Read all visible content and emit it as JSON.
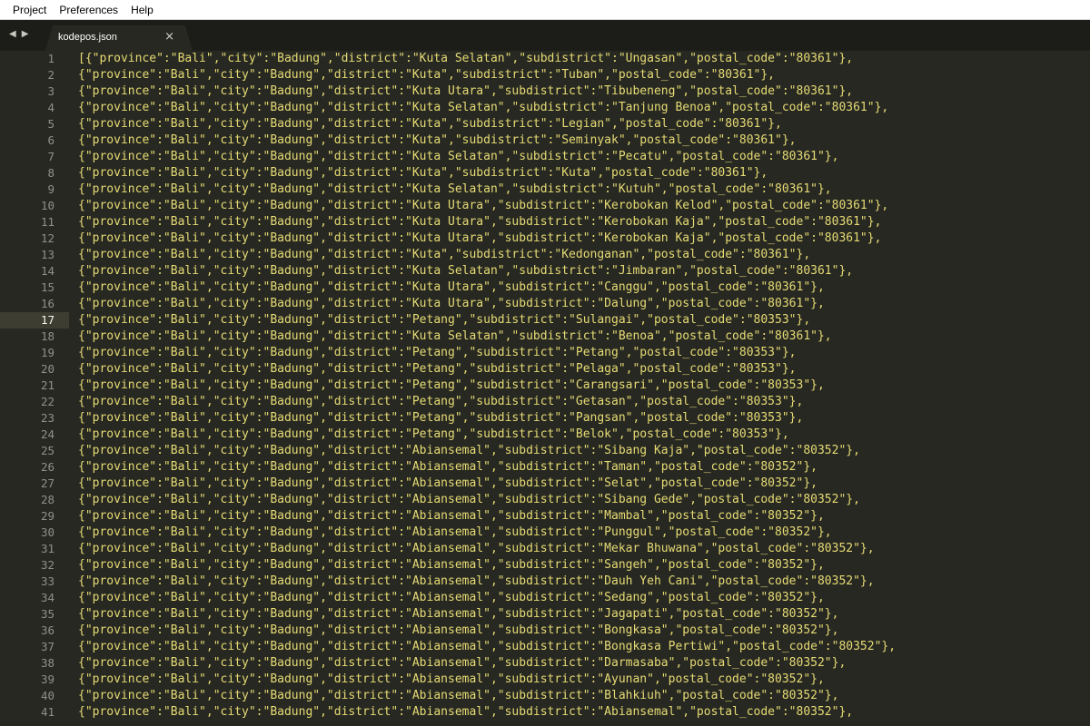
{
  "menu": [
    "Project",
    "Preferences",
    "Help"
  ],
  "tab": {
    "title": "kodepos.json",
    "close": "×"
  },
  "nav": {
    "back": "◀",
    "forward": "▶"
  },
  "active_line": 17,
  "lines": [
    "[{\"province\":\"Bali\",\"city\":\"Badung\",\"district\":\"Kuta Selatan\",\"subdistrict\":\"Ungasan\",\"postal_code\":\"80361\"},",
    "{\"province\":\"Bali\",\"city\":\"Badung\",\"district\":\"Kuta\",\"subdistrict\":\"Tuban\",\"postal_code\":\"80361\"},",
    "{\"province\":\"Bali\",\"city\":\"Badung\",\"district\":\"Kuta Utara\",\"subdistrict\":\"Tibubeneng\",\"postal_code\":\"80361\"},",
    "{\"province\":\"Bali\",\"city\":\"Badung\",\"district\":\"Kuta Selatan\",\"subdistrict\":\"Tanjung Benoa\",\"postal_code\":\"80361\"},",
    "{\"province\":\"Bali\",\"city\":\"Badung\",\"district\":\"Kuta\",\"subdistrict\":\"Legian\",\"postal_code\":\"80361\"},",
    "{\"province\":\"Bali\",\"city\":\"Badung\",\"district\":\"Kuta\",\"subdistrict\":\"Seminyak\",\"postal_code\":\"80361\"},",
    "{\"province\":\"Bali\",\"city\":\"Badung\",\"district\":\"Kuta Selatan\",\"subdistrict\":\"Pecatu\",\"postal_code\":\"80361\"},",
    "{\"province\":\"Bali\",\"city\":\"Badung\",\"district\":\"Kuta\",\"subdistrict\":\"Kuta\",\"postal_code\":\"80361\"},",
    "{\"province\":\"Bali\",\"city\":\"Badung\",\"district\":\"Kuta Selatan\",\"subdistrict\":\"Kutuh\",\"postal_code\":\"80361\"},",
    "{\"province\":\"Bali\",\"city\":\"Badung\",\"district\":\"Kuta Utara\",\"subdistrict\":\"Kerobokan Kelod\",\"postal_code\":\"80361\"},",
    "{\"province\":\"Bali\",\"city\":\"Badung\",\"district\":\"Kuta Utara\",\"subdistrict\":\"Kerobokan Kaja\",\"postal_code\":\"80361\"},",
    "{\"province\":\"Bali\",\"city\":\"Badung\",\"district\":\"Kuta Utara\",\"subdistrict\":\"Kerobokan Kaja\",\"postal_code\":\"80361\"},",
    "{\"province\":\"Bali\",\"city\":\"Badung\",\"district\":\"Kuta\",\"subdistrict\":\"Kedonganan\",\"postal_code\":\"80361\"},",
    "{\"province\":\"Bali\",\"city\":\"Badung\",\"district\":\"Kuta Selatan\",\"subdistrict\":\"Jimbaran\",\"postal_code\":\"80361\"},",
    "{\"province\":\"Bali\",\"city\":\"Badung\",\"district\":\"Kuta Utara\",\"subdistrict\":\"Canggu\",\"postal_code\":\"80361\"},",
    "{\"province\":\"Bali\",\"city\":\"Badung\",\"district\":\"Kuta Utara\",\"subdistrict\":\"Dalung\",\"postal_code\":\"80361\"},",
    "{\"province\":\"Bali\",\"city\":\"Badung\",\"district\":\"Petang\",\"subdistrict\":\"Sulangai\",\"postal_code\":\"80353\"},",
    "{\"province\":\"Bali\",\"city\":\"Badung\",\"district\":\"Kuta Selatan\",\"subdistrict\":\"Benoa\",\"postal_code\":\"80361\"},",
    "{\"province\":\"Bali\",\"city\":\"Badung\",\"district\":\"Petang\",\"subdistrict\":\"Petang\",\"postal_code\":\"80353\"},",
    "{\"province\":\"Bali\",\"city\":\"Badung\",\"district\":\"Petang\",\"subdistrict\":\"Pelaga\",\"postal_code\":\"80353\"},",
    "{\"province\":\"Bali\",\"city\":\"Badung\",\"district\":\"Petang\",\"subdistrict\":\"Carangsari\",\"postal_code\":\"80353\"},",
    "{\"province\":\"Bali\",\"city\":\"Badung\",\"district\":\"Petang\",\"subdistrict\":\"Getasan\",\"postal_code\":\"80353\"},",
    "{\"province\":\"Bali\",\"city\":\"Badung\",\"district\":\"Petang\",\"subdistrict\":\"Pangsan\",\"postal_code\":\"80353\"},",
    "{\"province\":\"Bali\",\"city\":\"Badung\",\"district\":\"Petang\",\"subdistrict\":\"Belok\",\"postal_code\":\"80353\"},",
    "{\"province\":\"Bali\",\"city\":\"Badung\",\"district\":\"Abiansemal\",\"subdistrict\":\"Sibang Kaja\",\"postal_code\":\"80352\"},",
    "{\"province\":\"Bali\",\"city\":\"Badung\",\"district\":\"Abiansemal\",\"subdistrict\":\"Taman\",\"postal_code\":\"80352\"},",
    "{\"province\":\"Bali\",\"city\":\"Badung\",\"district\":\"Abiansemal\",\"subdistrict\":\"Selat\",\"postal_code\":\"80352\"},",
    "{\"province\":\"Bali\",\"city\":\"Badung\",\"district\":\"Abiansemal\",\"subdistrict\":\"Sibang Gede\",\"postal_code\":\"80352\"},",
    "{\"province\":\"Bali\",\"city\":\"Badung\",\"district\":\"Abiansemal\",\"subdistrict\":\"Mambal\",\"postal_code\":\"80352\"},",
    "{\"province\":\"Bali\",\"city\":\"Badung\",\"district\":\"Abiansemal\",\"subdistrict\":\"Punggul\",\"postal_code\":\"80352\"},",
    "{\"province\":\"Bali\",\"city\":\"Badung\",\"district\":\"Abiansemal\",\"subdistrict\":\"Mekar Bhuwana\",\"postal_code\":\"80352\"},",
    "{\"province\":\"Bali\",\"city\":\"Badung\",\"district\":\"Abiansemal\",\"subdistrict\":\"Sangeh\",\"postal_code\":\"80352\"},",
    "{\"province\":\"Bali\",\"city\":\"Badung\",\"district\":\"Abiansemal\",\"subdistrict\":\"Dauh Yeh Cani\",\"postal_code\":\"80352\"},",
    "{\"province\":\"Bali\",\"city\":\"Badung\",\"district\":\"Abiansemal\",\"subdistrict\":\"Sedang\",\"postal_code\":\"80352\"},",
    "{\"province\":\"Bali\",\"city\":\"Badung\",\"district\":\"Abiansemal\",\"subdistrict\":\"Jagapati\",\"postal_code\":\"80352\"},",
    "{\"province\":\"Bali\",\"city\":\"Badung\",\"district\":\"Abiansemal\",\"subdistrict\":\"Bongkasa\",\"postal_code\":\"80352\"},",
    "{\"province\":\"Bali\",\"city\":\"Badung\",\"district\":\"Abiansemal\",\"subdistrict\":\"Bongkasa Pertiwi\",\"postal_code\":\"80352\"},",
    "{\"province\":\"Bali\",\"city\":\"Badung\",\"district\":\"Abiansemal\",\"subdistrict\":\"Darmasaba\",\"postal_code\":\"80352\"},",
    "{\"province\":\"Bali\",\"city\":\"Badung\",\"district\":\"Abiansemal\",\"subdistrict\":\"Ayunan\",\"postal_code\":\"80352\"},",
    "{\"province\":\"Bali\",\"city\":\"Badung\",\"district\":\"Abiansemal\",\"subdistrict\":\"Blahkiuh\",\"postal_code\":\"80352\"},",
    "{\"province\":\"Bali\",\"city\":\"Badung\",\"district\":\"Abiansemal\",\"subdistrict\":\"Abiansemal\",\"postal_code\":\"80352\"},"
  ],
  "colors": {
    "background": "#272822",
    "text": "#e6db74",
    "gutter_text": "#8f908a"
  }
}
